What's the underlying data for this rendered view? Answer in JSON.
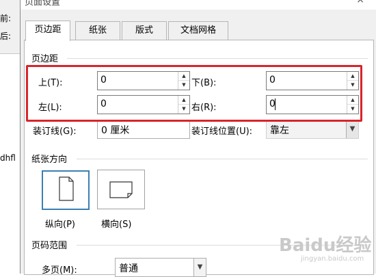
{
  "background": {
    "label_before": "前:",
    "label_after": "后:",
    "fragment": "dhfl"
  },
  "dialog": {
    "title": "页面设置",
    "close_glyph": "×"
  },
  "tabs": [
    "页边距",
    "纸张",
    "版式",
    "文档网格"
  ],
  "margins": {
    "group_title": "页边距",
    "top_label": "上(T):",
    "top_value": "0",
    "bottom_label": "下(B):",
    "bottom_value": "0",
    "left_label": "左(L):",
    "left_value": "0",
    "right_label": "右(R):",
    "right_value": "0",
    "gutter_label": "装订线(G):",
    "gutter_value": "0 厘米",
    "gutter_pos_label": "装订线位置(U):",
    "gutter_pos_value": "靠左"
  },
  "orientation": {
    "group_title": "纸张方向",
    "portrait_label": "纵向(P)",
    "landscape_label": "横向(S)"
  },
  "pages": {
    "group_title": "页码范围",
    "multiple_label": "多页(M):",
    "multiple_value": "普通"
  },
  "watermark": {
    "text": "Baidu经验",
    "url": "jingyan.baidu.com"
  },
  "colors": {
    "highlight": "#d9242b",
    "selected_border": "#3c7fb1"
  }
}
